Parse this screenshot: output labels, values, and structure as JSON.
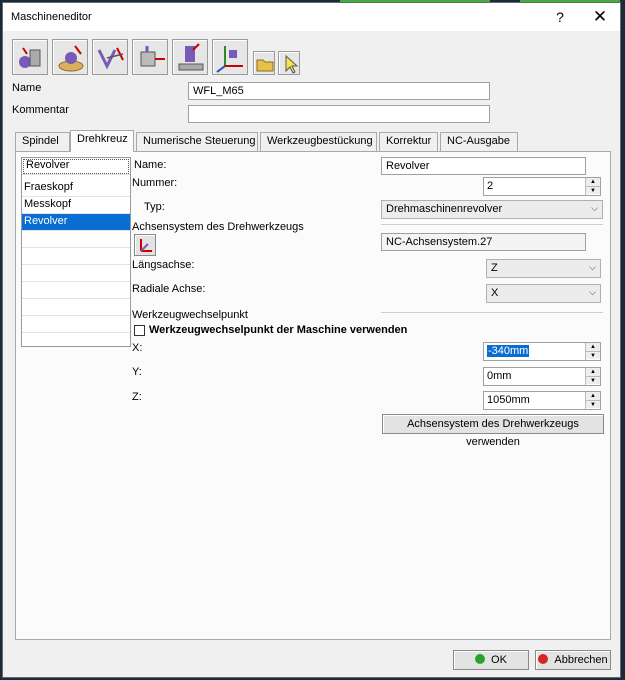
{
  "window": {
    "title": "Maschineneditor",
    "help_label": "?",
    "close_label": "✕"
  },
  "form": {
    "name_label": "Name",
    "name_value": "WFL_M65",
    "comment_label": "Kommentar",
    "comment_value": ""
  },
  "tabs": [
    {
      "label": "Spindel"
    },
    {
      "label": "Drehkreuz"
    },
    {
      "label": "Numerische Steuerung"
    },
    {
      "label": "Werkzeugbestückung"
    },
    {
      "label": "Korrektur"
    },
    {
      "label": "NC-Ausgabe"
    }
  ],
  "list": [
    {
      "label": "Revolver"
    },
    {
      "label": "Fraeskopf"
    },
    {
      "label": "Messkopf"
    },
    {
      "label": "Revolver"
    }
  ],
  "detail": {
    "name_label": "Name:",
    "name_value": "Revolver",
    "number_label": "Nummer:",
    "number_value": "2",
    "type_label": "Typ:",
    "type_value": "Drehmaschinenrevolver",
    "axis_system_label": "Achsensystem des Drehwerkzeugs",
    "axis_system_value": "NC-Achsensystem.27",
    "long_axis_label": "Längsachse:",
    "long_axis_value": "Z",
    "radial_axis_label": "Radiale Achse:",
    "radial_axis_value": "X",
    "tool_change_label": "Werkzeugwechselpunkt",
    "use_machine_label": "Werkzeugwechselpunkt der Maschine verwenden",
    "x_label": "X:",
    "x_value": "-340mm",
    "y_label": "Y:",
    "y_value": "0mm",
    "z_label": "Z:",
    "z_value": "1050mm",
    "use_axis_button": "Achsensystem des Drehwerkzeugs verwenden"
  },
  "footer": {
    "ok_label": "OK",
    "cancel_label": "Abbrechen"
  },
  "colors": {
    "selection": "#0a6dd1",
    "ok_icon": "#2ca02c",
    "cancel_icon": "#d62728"
  }
}
